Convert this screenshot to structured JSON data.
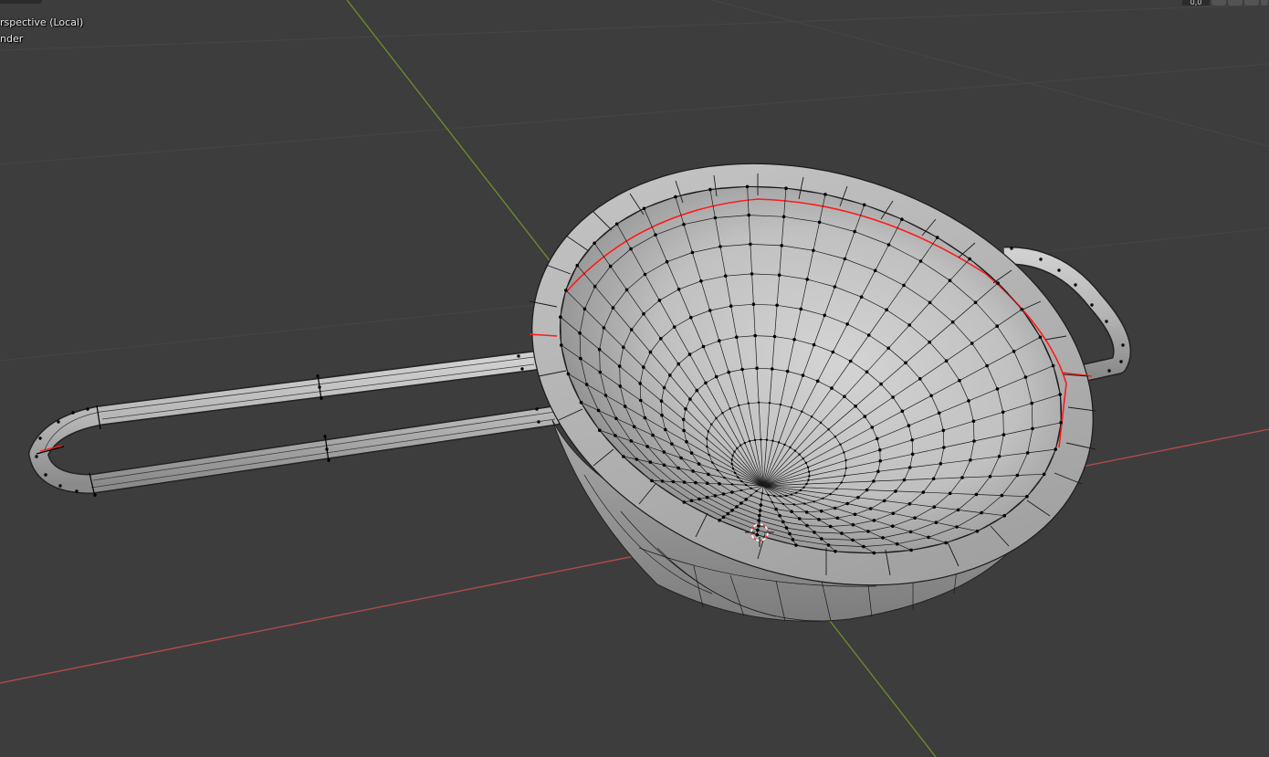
{
  "viewport": {
    "view_name": "rspective (Local)",
    "object_name": "nder",
    "header_value": "0,0"
  },
  "colors": {
    "background": "#3d3d3d",
    "grid": "#484848",
    "axis_x": "#b04a4a",
    "axis_y": "#6a8a2a",
    "mesh": "#bdbdbd",
    "wire": "#000000",
    "seam": "#ff1a1a"
  },
  "icons": [
    "3d-cursor-icon"
  ]
}
